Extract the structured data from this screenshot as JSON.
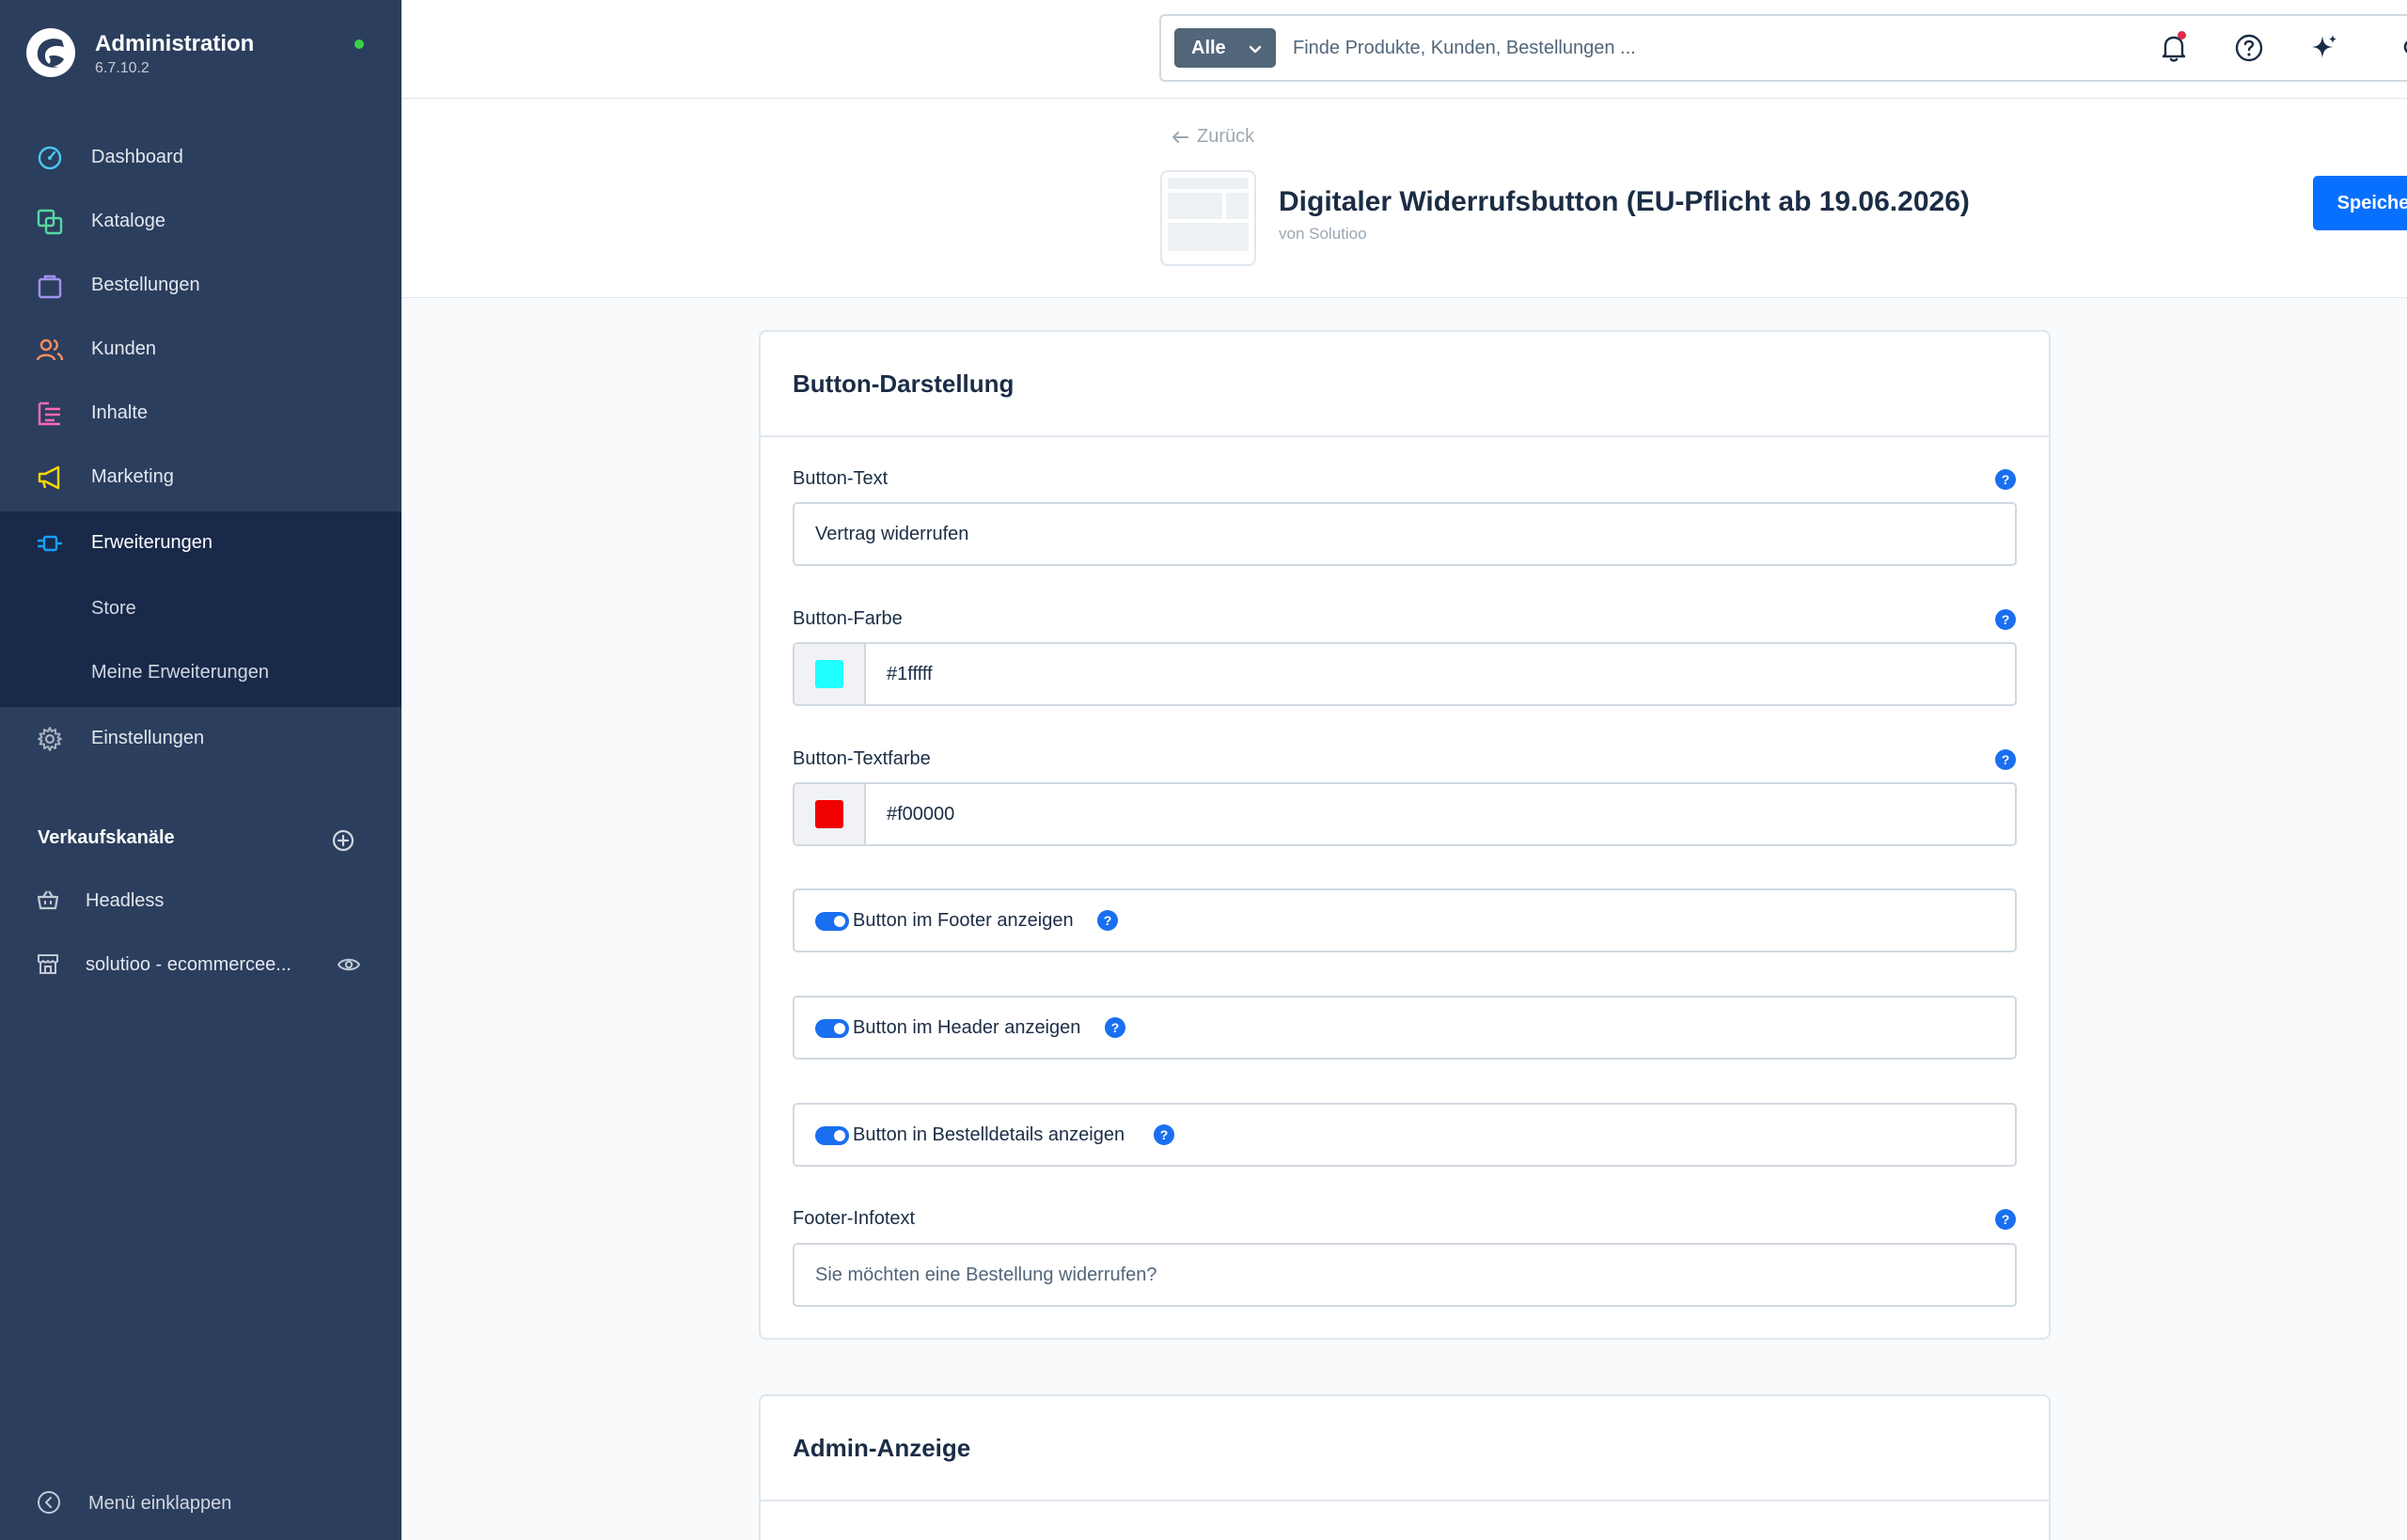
{
  "app": {
    "title": "Administration",
    "version": "6.7.10.2"
  },
  "nav": {
    "items": [
      {
        "label": "Dashboard",
        "icon": "dashboard-icon"
      },
      {
        "label": "Kataloge",
        "icon": "catalog-icon"
      },
      {
        "label": "Bestellungen",
        "icon": "orders-icon"
      },
      {
        "label": "Kunden",
        "icon": "customers-icon"
      },
      {
        "label": "Inhalte",
        "icon": "content-icon"
      },
      {
        "label": "Marketing",
        "icon": "marketing-icon"
      },
      {
        "label": "Erweiterungen",
        "icon": "extensions-icon"
      },
      {
        "label": "Einstellungen",
        "icon": "settings-icon"
      }
    ],
    "sub_items": [
      "Store",
      "Meine Erweiterungen"
    ],
    "active": "Erweiterungen"
  },
  "sales_channels": {
    "title": "Verkaufskanäle",
    "items": [
      {
        "label": "Headless",
        "icon": "basket-icon"
      },
      {
        "label": "solutioo - ecommercee...",
        "icon": "storefront-icon"
      }
    ]
  },
  "collapse_label": "Menü einklappen",
  "search": {
    "type_label": "Alle",
    "placeholder": "Finde Produkte, Kunden, Bestellungen ..."
  },
  "page": {
    "back_label": "Zurück",
    "title": "Digitaler Widerrufsbutton (EU-Pflicht ab 19.06.2026)",
    "subtitle": "von Solutioo",
    "save_label": "Speichern"
  },
  "card_display": {
    "title": "Button-Darstellung",
    "button_text": {
      "label": "Button-Text",
      "value": "Vertrag widerrufen"
    },
    "button_color": {
      "label": "Button-Farbe",
      "value": "#1fffff"
    },
    "button_text_color": {
      "label": "Button-Textfarbe",
      "value": "#f00000"
    },
    "toggles": [
      {
        "label": "Button im Footer anzeigen",
        "enabled": true
      },
      {
        "label": "Button im Header anzeigen",
        "enabled": true
      },
      {
        "label": "Button in Bestelldetails anzeigen",
        "enabled": true
      }
    ],
    "footer_info": {
      "label": "Footer-Infotext",
      "placeholder": "Sie möchten eine Bestellung widerrufen?"
    },
    "help_glyph": "?"
  },
  "card_admin": {
    "title": "Admin-Anzeige"
  },
  "colors": {
    "sidebar": "#2c3e5d",
    "sidebar_active": "#19294a",
    "primary": "#0870ff",
    "status_online": "#37d046"
  }
}
